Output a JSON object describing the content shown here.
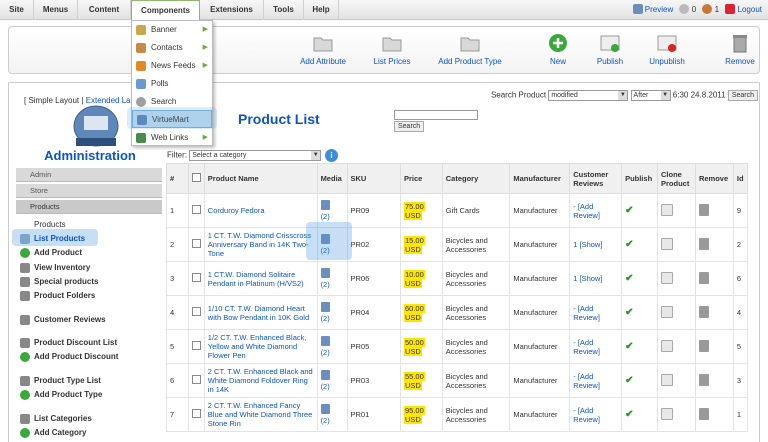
{
  "menubar": {
    "items": [
      "Site",
      "Menus",
      "Content",
      "Components",
      "Extensions",
      "Tools",
      "Help"
    ],
    "preview": "Preview",
    "messages": "0",
    "users": "1",
    "logout": "Logout"
  },
  "components_menu": [
    {
      "label": "Banner",
      "icon": "banner-icon",
      "submenu": true
    },
    {
      "label": "Contacts",
      "icon": "contacts-icon",
      "submenu": true
    },
    {
      "label": "News Feeds",
      "icon": "newsfeeds-icon",
      "submenu": true
    },
    {
      "label": "Polls",
      "icon": "polls-icon",
      "submenu": false
    },
    {
      "label": "Search",
      "icon": "search-icon",
      "submenu": false
    },
    {
      "label": "VirtueMart",
      "icon": "virtuemart-icon",
      "submenu": false
    },
    {
      "label": "Web Links",
      "icon": "weblinks-icon",
      "submenu": true
    }
  ],
  "toolbar": {
    "buttons": [
      "Add Attribute",
      "List Prices",
      "Add Product Type",
      "New",
      "Publish",
      "Unpublish",
      "Remove"
    ]
  },
  "layout_links": {
    "simple": "[ Simple Layout |",
    "extended": "Extended La"
  },
  "sidebar": {
    "title": "Administration",
    "sections": [
      "Admin",
      "Store",
      "Products"
    ],
    "products_label": "Products",
    "items": [
      "List Products",
      "Add Product",
      "View Inventory",
      "Special products",
      "Product Folders",
      "Customer Reviews",
      "Product Discount List",
      "Add Product Discount",
      "Product Type List",
      "Add Product Type",
      "List Categories",
      "Add Category"
    ]
  },
  "page_title": "Product List",
  "search": {
    "label": "Search Product",
    "field": "modified",
    "when": "After",
    "date": "6:30 24.8.2011",
    "button": "Search",
    "button2": "Search"
  },
  "filter": {
    "label": "Filter:",
    "value": "Select a category"
  },
  "table": {
    "headers": [
      "#",
      "",
      "Product Name",
      "Media",
      "SKU",
      "Price",
      "Category",
      "Manufacturer",
      "Customer Reviews",
      "Publish",
      "Clone Product",
      "Remove",
      "Id"
    ],
    "rows": [
      {
        "n": "1",
        "name": "Corduroy Fedora",
        "media": "(2)",
        "sku": "PR09",
        "price": "75.00",
        "cur": "USD",
        "cat": "Gift Cards",
        "manu": "Manufacturer",
        "rev1": "- [Add",
        "rev2": "Review]",
        "id": "9"
      },
      {
        "n": "2",
        "name": "1 CT. T.W. Diamond Crisscross Anniversary Band in 14K Two-Tone",
        "media": "(2)",
        "sku": "PR02",
        "price": "15.00",
        "cur": "USD",
        "cat": "Bicycles and Accessories",
        "manu": "Manufacturer",
        "rev1": "1 [Show]",
        "rev2": "",
        "id": "2"
      },
      {
        "n": "3",
        "name": "1 CT.W. Diamond Solitaire Pendant in Platinum (H/VS2)",
        "media": "(2)",
        "sku": "PR06",
        "price": "10.00",
        "cur": "USD",
        "cat": "Bicycles and Accessories",
        "manu": "Manufacturer",
        "rev1": "1 [Show]",
        "rev2": "",
        "id": "6"
      },
      {
        "n": "4",
        "name": "1/10 CT. T.W. Diamond Heart with Bow Pendant in 10K Gold",
        "media": "(2)",
        "sku": "PR04",
        "price": "60.00",
        "cur": "USD",
        "cat": "Bicycles and Accessories",
        "manu": "Manufacturer",
        "rev1": "- [Add",
        "rev2": "Review]",
        "id": "4"
      },
      {
        "n": "5",
        "name": "1/2 CT. T.W. Enhanced Black, Yellow and White Diamond Flower Pen",
        "media": "(2)",
        "sku": "PR05",
        "price": "50.00",
        "cur": "USD",
        "cat": "Bicycles and Accessories",
        "manu": "Manufacturer",
        "rev1": "- [Add",
        "rev2": "Review]",
        "id": "5"
      },
      {
        "n": "6",
        "name": "2 CT. T.W. Enhanced Black and White Diamond Foldover Ring in 14K",
        "media": "(2)",
        "sku": "PR03",
        "price": "55.00",
        "cur": "USD",
        "cat": "Bicycles and Accessories",
        "manu": "Manufacturer",
        "rev1": "- [Add",
        "rev2": "Review]",
        "id": "3"
      },
      {
        "n": "7",
        "name": "2 CT. T.W. Enhanced Fancy Blue and White Diamond Three Stone Rin",
        "media": "(2)",
        "sku": "PR01",
        "price": "95.00",
        "cur": "USD",
        "cat": "Bicycles and Accessories",
        "manu": "Manufacturer",
        "rev1": "- [Add",
        "rev2": "Review]",
        "id": "1"
      }
    ]
  },
  "colors": {
    "accent": "#0b55c4",
    "price_highlight": "#ffe600",
    "publish_check": "#1e9a1e",
    "highlight": "#4696dc"
  }
}
